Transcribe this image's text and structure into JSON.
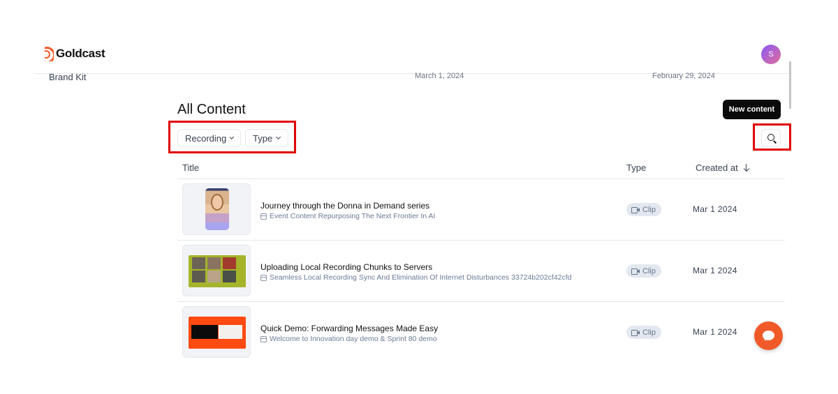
{
  "header": {
    "brand": "Goldcast",
    "avatar_initial": "S"
  },
  "background_row": {
    "label": "Brand Kit",
    "date_1": "March 1, 2024",
    "date_2": "February 29, 2024"
  },
  "page": {
    "title": "All Content",
    "new_content_label": "New content"
  },
  "filters": {
    "recording_label": "Recording",
    "type_label": "Type"
  },
  "table": {
    "columns": {
      "title": "Title",
      "type": "Type",
      "created_at": "Created at"
    },
    "rows": [
      {
        "title": "Journey through the Donna in Demand series",
        "subtitle": "Event Content Repurposing The Next Frontier In AI",
        "type": "Clip",
        "created": "Mar 1 2024"
      },
      {
        "title": "Uploading Local Recording Chunks to Servers",
        "subtitle": "Seamless Local Recording Sync And Elimination Of Internet Disturbances 33724b202cf42cfd",
        "type": "Clip",
        "created": "Mar 1 2024"
      },
      {
        "title": "Quick Demo: Forwarding Messages Made Easy",
        "subtitle": "Welcome to Innovation day demo & Sprint 80 demo",
        "type": "Clip",
        "created": "Mar 1 2024"
      }
    ]
  },
  "colors": {
    "brand_orange": "#f05a28",
    "highlight_red": "#e00000",
    "badge_bg": "#e3e8f0"
  },
  "icons": [
    "goldcast-logo-icon",
    "chevron-down-icon",
    "search-icon",
    "sort-arrow-down-icon",
    "calendar-icon",
    "video-icon",
    "chat-icon"
  ]
}
